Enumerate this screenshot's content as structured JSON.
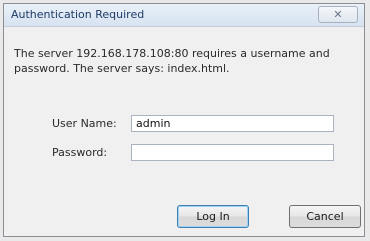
{
  "dialog": {
    "title": "Authentication Required",
    "close_glyph": "✕",
    "message_line1": "The server 192.168.178.108:80 requires a username and",
    "message_line2": "password. The server says: index.html.",
    "username_label": "User Name:",
    "username_value": "admin",
    "password_label": "Password:",
    "password_value": "",
    "login_label": "Log In",
    "cancel_label": "Cancel"
  },
  "icons": {
    "close": "close-icon"
  }
}
